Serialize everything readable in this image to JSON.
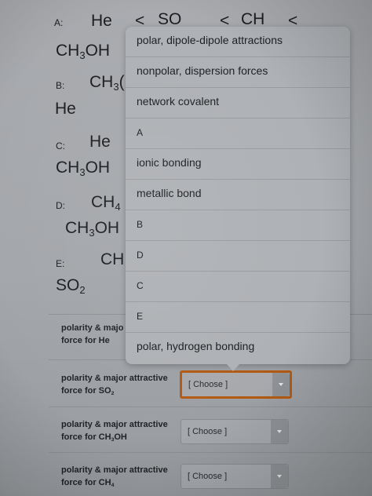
{
  "background_rows": {
    "a": {
      "letter": "A:",
      "line1": "He",
      "line1_rest": "<",
      "line1_mid": "SO",
      "line1_rest2": "<",
      "line1_end": "CH",
      "line1_end2": "<",
      "line2_pre": "CH",
      "line2_sub": "3",
      "line2_post": "OH"
    },
    "b": {
      "letter": "B:",
      "line1_pre": "CH",
      "line1_sub": "3",
      "line1_post": "(",
      "line2": "He"
    },
    "c": {
      "letter": "C:",
      "line1": "He",
      "line2_pre": "CH",
      "line2_sub": "3",
      "line2_post": "OH"
    },
    "d": {
      "letter": "D:",
      "line1_pre": "CH",
      "line1_sub": "4",
      "line2_pre": "CH",
      "line2_sub": "3",
      "line2_post": "OH"
    },
    "e": {
      "letter": "E:",
      "line1": "CH",
      "line1_post": ",",
      "line2_pre": "SO",
      "line2_sub": "2"
    }
  },
  "dropdown": {
    "options": [
      "polar, dipole-dipole attractions",
      "nonpolar, dispersion forces",
      "network covalent",
      "A",
      "ionic bonding",
      "metallic bond",
      "B",
      "D",
      "C",
      "E",
      "polar, hydrogen bonding"
    ]
  },
  "questions": [
    {
      "line1": "polarity & majo",
      "line2": "force for He"
    },
    {
      "line1": "polarity & major attractive",
      "line2_pre": "force for SO",
      "line2_sub": "2",
      "select": "[ Choose ]"
    },
    {
      "line1": "polarity & major attractive",
      "line2_pre": "force for CH",
      "line2_sub": "3",
      "line2_post": "OH",
      "select": "[ Choose ]"
    },
    {
      "line1": "polarity & major attractive",
      "line2_pre": "force for CH",
      "line2_sub": "4",
      "select": "[ Choose ]"
    }
  ]
}
